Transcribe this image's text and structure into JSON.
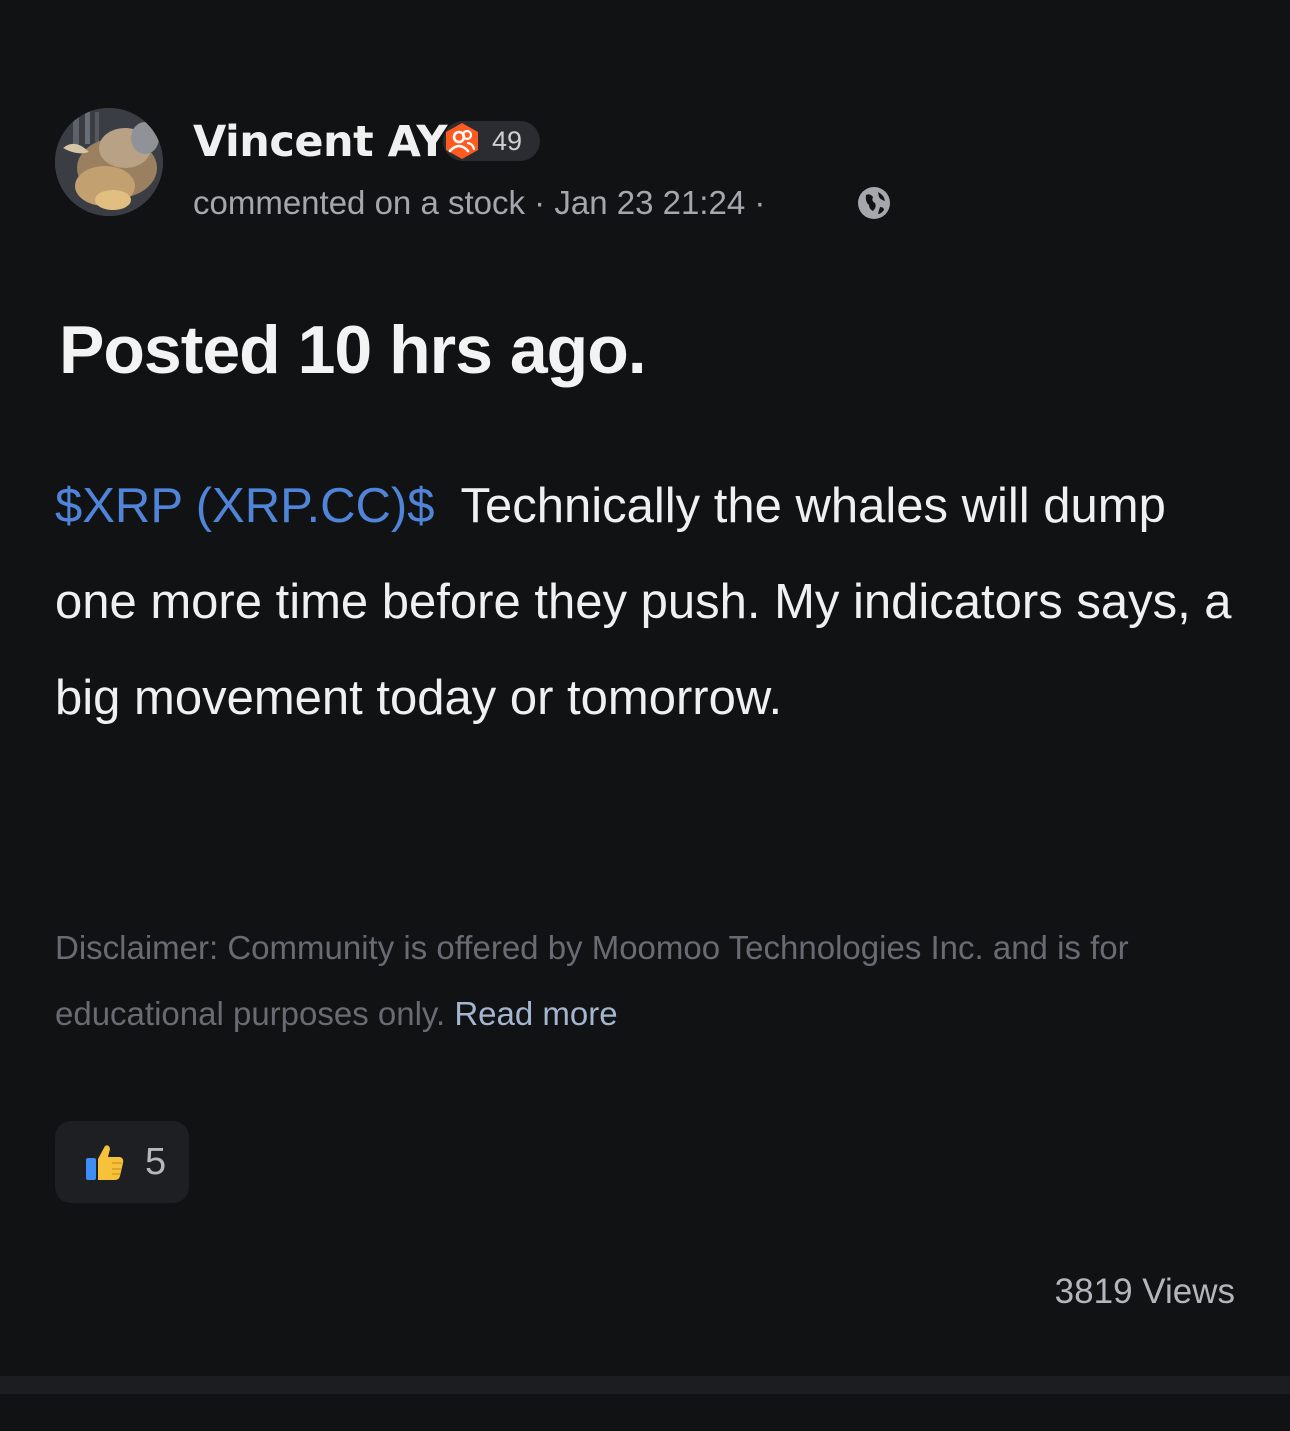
{
  "post": {
    "author": {
      "name": "Vincent AY",
      "badge_count": "49",
      "badge_color": "#ff5a1f"
    },
    "meta": {
      "action": "commented on a stock",
      "timestamp": "Jan 23 21:24",
      "visibility_icon": "globe-icon"
    },
    "title": "Posted 10 hrs ago.",
    "body": {
      "ticker": "$XRP (XRP.CC)$",
      "text": "Technically the whales will dump one more time before they push. My indicators says, a big movement today or tomorrow."
    },
    "disclaimer": {
      "text": "Disclaimer: Community is offered by Moomoo Technologies Inc. and is for educational purposes only.",
      "read_more": "Read more"
    },
    "reactions": {
      "icon": "thumbs-up-icon",
      "count": "5"
    },
    "views": "3819 Views"
  },
  "colors": {
    "background": "#111214",
    "ticker_link": "#4f84d8",
    "read_more_link": "#a4b5cf"
  }
}
